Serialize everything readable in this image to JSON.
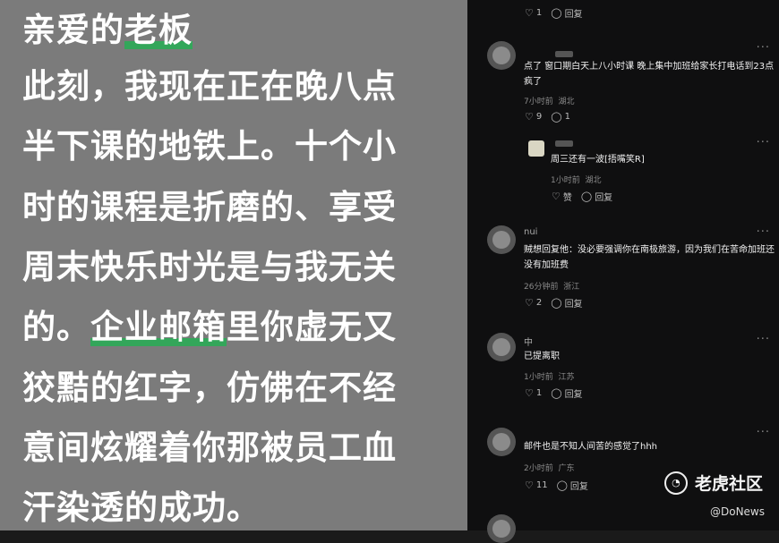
{
  "letter": {
    "lines": [
      {
        "pre": "亲爱的",
        "hl": "老板",
        "post": ""
      },
      {
        "pre": "此刻，我现在正在晚八点",
        "hl": "",
        "post": ""
      },
      {
        "pre": "半下课的地铁上。十个小",
        "hl": "",
        "post": ""
      },
      {
        "pre": "时的课程是折磨的、享受",
        "hl": "",
        "post": ""
      },
      {
        "pre": "周末快乐时光是与我无关",
        "hl": "",
        "post": ""
      },
      {
        "pre": "的。",
        "hl": "企业邮箱",
        "post": "里你虚无又"
      },
      {
        "pre": "狡黠的红字，仿佛在不经",
        "hl": "",
        "post": ""
      },
      {
        "pre": "意间炫耀着你那被员工血",
        "hl": "",
        "post": ""
      },
      {
        "pre": "汗染透的成功。",
        "hl": "",
        "post": ""
      }
    ]
  },
  "comments": {
    "c0": {
      "likes": "1",
      "reply": "回复"
    },
    "c1": {
      "user": "",
      "text": "点了 窗口期白天上八小时课 晚上集中加班给家长打电话到23点 疯了",
      "time": "7小时前",
      "loc": "湖北",
      "likes": "9",
      "replies": "1"
    },
    "c2": {
      "user": "",
      "text": "周三还有一波[捂嘴笑R]",
      "time": "1小时前",
      "loc": "湖北",
      "likes": "赞",
      "reply": "回复"
    },
    "c3": {
      "user": "nui",
      "text": "贼想回复他：没必要强调你在南极旅游，因为我们在苦命加班还没有加班费",
      "time": "26分钟前",
      "loc": "浙江",
      "likes": "2",
      "reply": "回复"
    },
    "c4": {
      "user": "中",
      "text": "已提离职",
      "time": "1小时前",
      "loc": "江苏",
      "likes": "1",
      "reply": "回复"
    },
    "c5": {
      "user": "",
      "text": "邮件也是不知人间苦的感觉了hhh",
      "time": "2小时前",
      "loc": "广东",
      "likes": "11",
      "reply": "回复"
    }
  },
  "dots": "···",
  "watermark": {
    "brand": "老虎社区",
    "credit": "@DoNews"
  }
}
